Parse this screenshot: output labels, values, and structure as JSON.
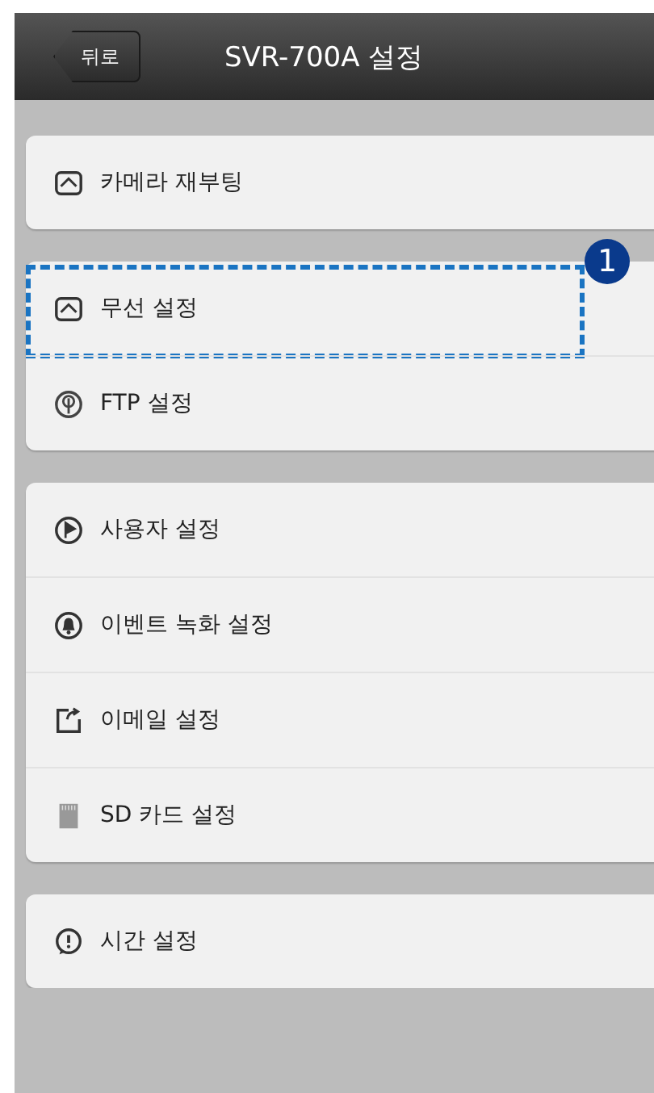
{
  "header": {
    "back_button": "뒤로",
    "title": "SVR-700A 설정"
  },
  "groups": [
    {
      "items": [
        {
          "kind": "wave",
          "label": "카메라 재부팅",
          "highlighted": false
        }
      ]
    },
    {
      "items": [
        {
          "kind": "wave",
          "label": "무선 설정",
          "highlighted": true,
          "callout": "1"
        },
        {
          "kind": "tree",
          "label": "FTP 설정",
          "highlighted": false
        }
      ]
    },
    {
      "items": [
        {
          "kind": "play",
          "label": "사용자 설정",
          "highlighted": false
        },
        {
          "kind": "bell",
          "label": "이벤트 녹화 설정",
          "highlighted": false
        },
        {
          "kind": "share",
          "label": "이메일 설정",
          "highlighted": false
        },
        {
          "kind": "sd",
          "label": "SD 카드 설정",
          "highlighted": false
        }
      ]
    },
    {
      "items": [
        {
          "kind": "alert",
          "label": "시간 설정",
          "highlighted": false
        }
      ]
    }
  ]
}
